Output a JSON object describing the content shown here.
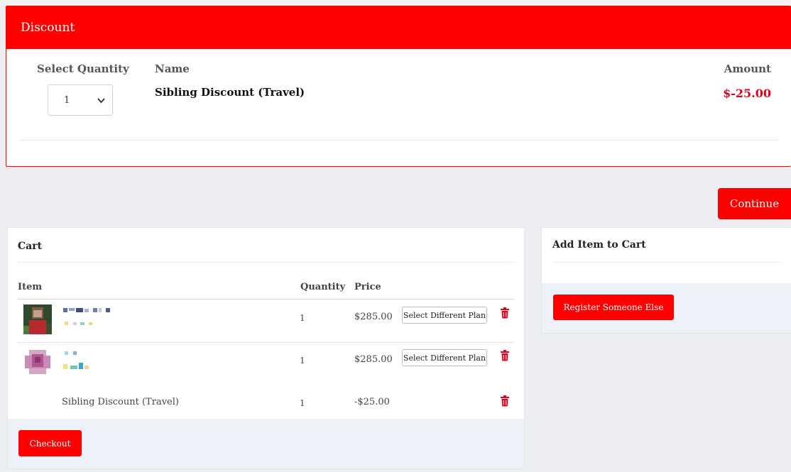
{
  "discount": {
    "header": "Discount",
    "col_quantity": "Select Quantity",
    "col_name": "Name",
    "col_amount": "Amount",
    "quantity_value": "1",
    "item_name": "Sibling Discount (Travel)",
    "amount": "$-25.00"
  },
  "continue_label": "Continue",
  "cart": {
    "title": "Cart",
    "headers": {
      "item": "Item",
      "quantity": "Quantity",
      "price": "Price"
    },
    "rows": [
      {
        "quantity": "1",
        "price": "$285.00",
        "action": "Select Different Plan"
      },
      {
        "quantity": "1",
        "price": "$285.00",
        "action": "Select Different Plan"
      },
      {
        "name": "Sibling Discount (Travel)",
        "quantity": "1",
        "price": "-$25.00"
      }
    ],
    "checkout_label": "Checkout"
  },
  "add_item": {
    "title": "Add Item to Cart",
    "register_label": "Register Someone Else"
  },
  "colors": {
    "accent": "#ff0000",
    "amount": "#e5001a",
    "panel_footer": "#edf1f8",
    "page_bg": "#eceef2"
  },
  "icons": {
    "dropdown": "chevron-down-icon",
    "delete": "trash-icon"
  }
}
